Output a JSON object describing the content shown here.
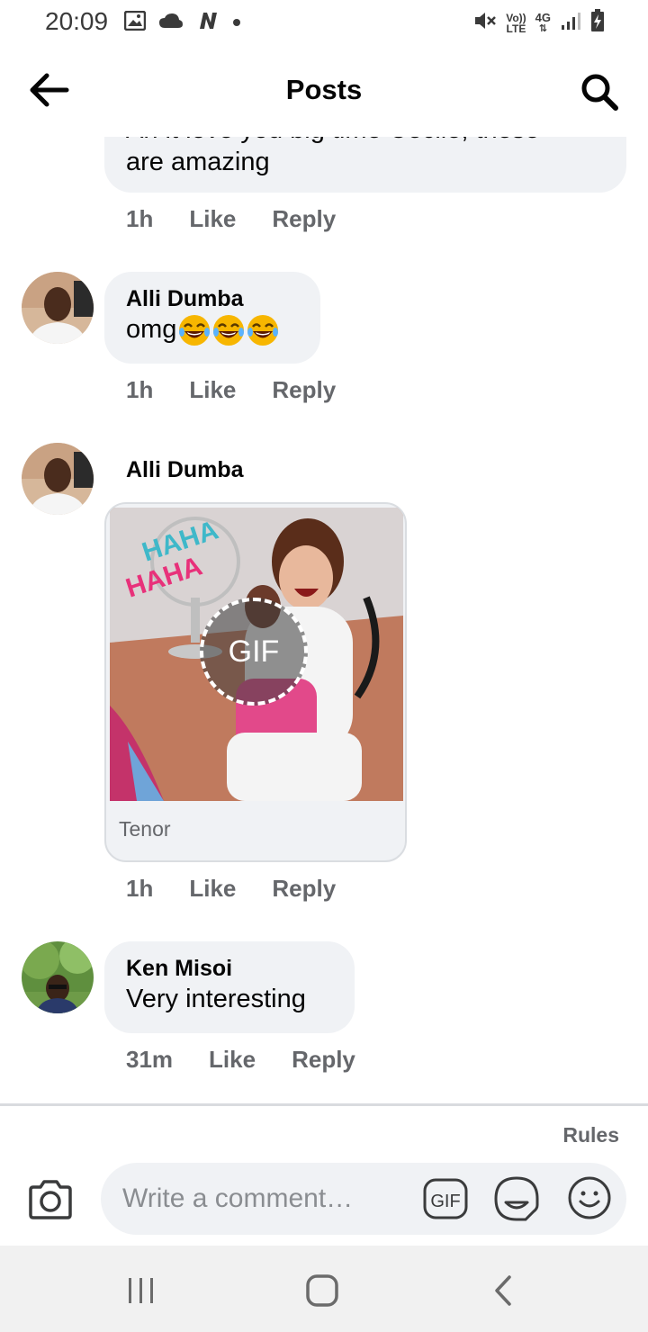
{
  "status_bar": {
    "time": "20:09",
    "left_icons": [
      "gallery-icon",
      "cloud-icon",
      "n-icon",
      "dot-icon"
    ],
    "right_icons": [
      "mute-icon",
      "volte-icon",
      "4g-icon",
      "signal-icon",
      "battery-icon"
    ],
    "volte_label_top": "Vo))",
    "volte_label_bottom": "LTE",
    "network_label": "4G"
  },
  "header": {
    "title": "Posts",
    "back_icon": "arrow-left-icon",
    "search_icon": "search-icon"
  },
  "comments": [
    {
      "author": "",
      "text_partial_top": "Ah it love you big time Cecile, these",
      "text": "are amazing",
      "time": "1h",
      "like": "Like",
      "reply": "Reply"
    },
    {
      "author": "Alli Dumba",
      "text": "omg",
      "emojis": [
        "face-with-tears-of-joy",
        "face-with-tears-of-joy",
        "face-with-tears-of-joy"
      ],
      "time": "1h",
      "like": "Like",
      "reply": "Reply"
    },
    {
      "author": "Alli Dumba",
      "gif": {
        "overlay_text_1": "HAHA",
        "overlay_text_2": "HAHA",
        "badge": "GIF",
        "source": "Tenor"
      },
      "time": "1h",
      "like": "Like",
      "reply": "Reply"
    },
    {
      "author": "Ken Misoi",
      "text": "Very interesting",
      "time": "31m",
      "like": "Like",
      "reply": "Reply"
    }
  ],
  "composer": {
    "rules_label": "Rules",
    "placeholder": "Write a comment…",
    "camera_icon": "camera-icon",
    "gif_label": "GIF",
    "sticker_icon": "sticker-icon",
    "emoji_icon": "smiley-icon"
  },
  "nav_bar": {
    "buttons": [
      "recent-apps-icon",
      "home-icon",
      "back-icon"
    ]
  },
  "colors": {
    "bubble": "#f0f2f5",
    "meta_text": "#65676b",
    "primary_text": "#050505",
    "divider": "#d9dbdf"
  }
}
